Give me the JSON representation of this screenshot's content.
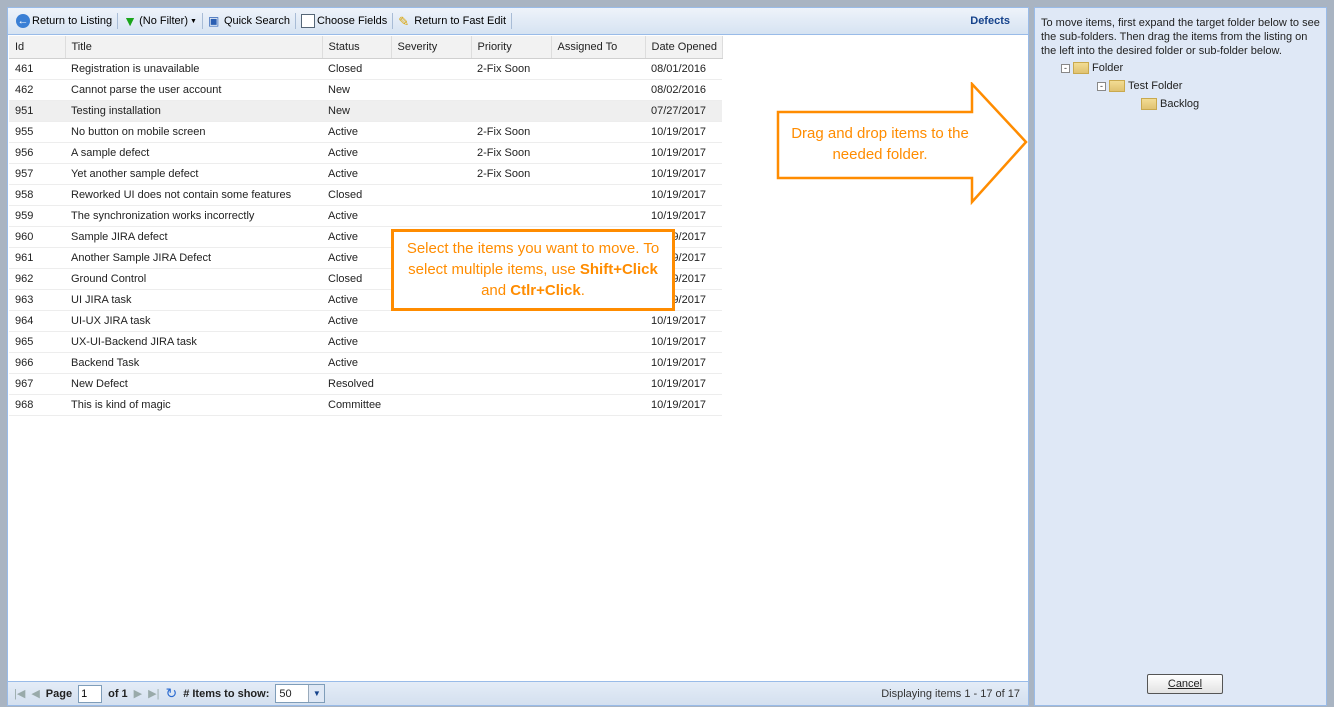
{
  "toolbar": {
    "return_listing": "Return to Listing",
    "filter": "(No Filter)",
    "quick_search": "Quick Search",
    "choose_fields": "Choose Fields",
    "return_fast_edit": "Return to Fast Edit",
    "title": "Defects"
  },
  "columns": [
    "Id",
    "Title",
    "Status",
    "Severity",
    "Priority",
    "Assigned To",
    "Date Opened"
  ],
  "rows": [
    [
      "461",
      "Registration is unavailable",
      "Closed",
      "",
      "2-Fix Soon",
      "",
      "08/01/2016"
    ],
    [
      "462",
      "Cannot parse the user account",
      "New",
      "",
      "",
      "",
      "08/02/2016"
    ],
    [
      "951",
      "Testing installation",
      "New",
      "",
      "",
      "",
      "07/27/2017"
    ],
    [
      "955",
      "No button on mobile screen",
      "Active",
      "",
      "2-Fix Soon",
      "",
      "10/19/2017"
    ],
    [
      "956",
      "A sample defect",
      "Active",
      "",
      "2-Fix Soon",
      "",
      "10/19/2017"
    ],
    [
      "957",
      "Yet another sample defect",
      "Active",
      "",
      "2-Fix Soon",
      "",
      "10/19/2017"
    ],
    [
      "958",
      "Reworked UI does not contain some features",
      "Closed",
      "",
      "",
      "",
      "10/19/2017"
    ],
    [
      "959",
      "The synchronization works incorrectly",
      "Active",
      "",
      "",
      "",
      "10/19/2017"
    ],
    [
      "960",
      "Sample JIRA defect",
      "Active",
      "",
      "",
      "",
      "10/19/2017"
    ],
    [
      "961",
      "Another Sample JIRA Defect",
      "Active",
      "",
      "",
      "",
      "10/19/2017"
    ],
    [
      "962",
      "Ground Control",
      "Closed",
      "",
      "",
      "",
      "10/19/2017"
    ],
    [
      "963",
      "UI JIRA task",
      "Active",
      "",
      "",
      "",
      "10/19/2017"
    ],
    [
      "964",
      "UI-UX JIRA task",
      "Active",
      "",
      "",
      "",
      "10/19/2017"
    ],
    [
      "965",
      "UX-UI-Backend JIRA task",
      "Active",
      "",
      "",
      "",
      "10/19/2017"
    ],
    [
      "966",
      "Backend Task",
      "Active",
      "",
      "",
      "",
      "10/19/2017"
    ],
    [
      "967",
      "New Defect",
      "Resolved",
      "",
      "",
      "",
      "10/19/2017"
    ],
    [
      "968",
      "This is kind of magic",
      "Committee",
      "",
      "",
      "",
      "10/19/2017"
    ]
  ],
  "selected_row": 2,
  "footer": {
    "page_label": "Page",
    "page_value": "1",
    "of_label": "of 1",
    "items_label": "# Items to show:",
    "items_value": "50",
    "display": "Displaying items 1 - 17 of 17"
  },
  "right": {
    "instructions": "To move items, first expand the target folder below to see the sub-folders. Then drag the items from the listing on the left into the desired folder or sub-folder below.",
    "tree": [
      "Folder",
      "Test Folder",
      "Backlog"
    ],
    "cancel": "Cancel"
  },
  "callouts": {
    "select_1": "Select the items you want to move. To select multiple items, use ",
    "shift": "Shift+Click",
    "and": " and ",
    "ctrl": "Ctlr+Click",
    "end": ".",
    "drag": "Drag and drop items to the needed folder."
  },
  "colors": {
    "accent": "#ff8c00",
    "header": "#15428b"
  }
}
